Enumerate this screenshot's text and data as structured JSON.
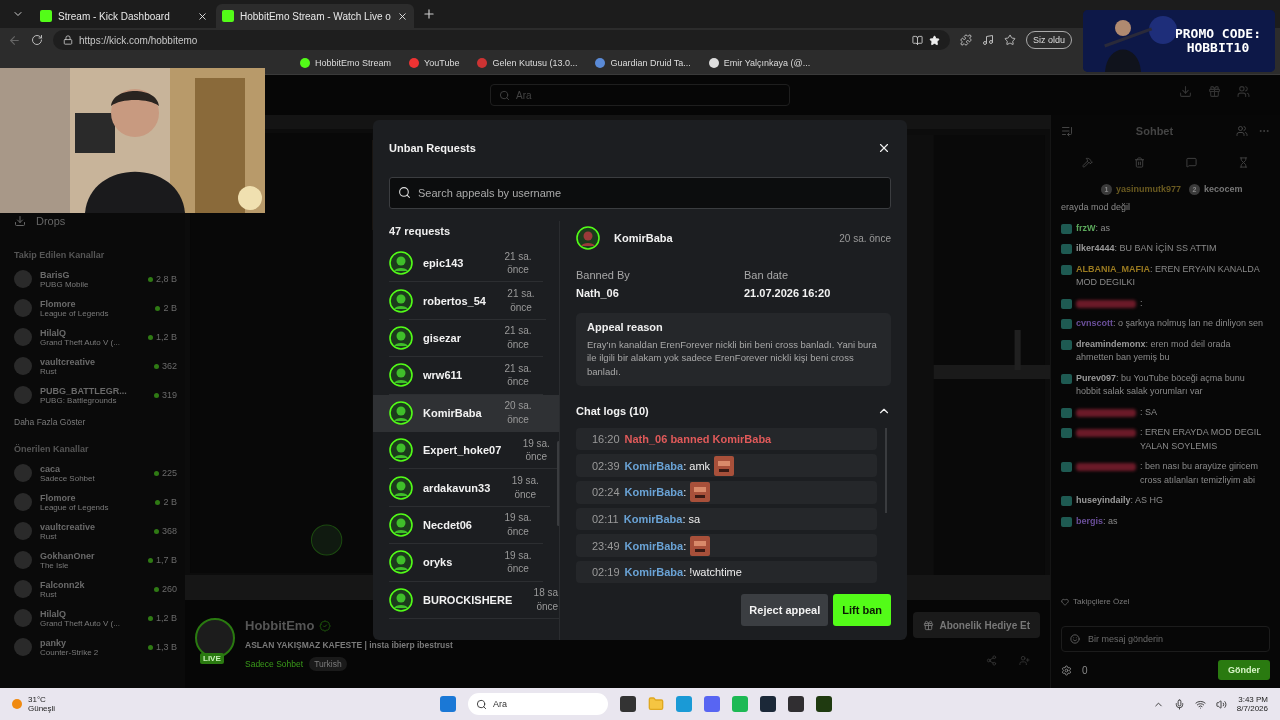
{
  "browser": {
    "tabs": [
      {
        "title": "Stream - Kick Dashboard",
        "selected": false
      },
      {
        "title": "HobbitEmo Stream - Watch Live o",
        "selected": true
      }
    ],
    "url": "https://kick.com/hobbitemo",
    "profile": "Siz oldu",
    "bookmarks": [
      "HobbitEmo Stream",
      "YouTube",
      "Gelen Kutusu (13.0...",
      "Guardian Druid Ta...",
      "Emir Yalçınkaya (@..."
    ]
  },
  "overlay": {
    "promo": [
      "PROMO CODE:",
      "HOBBIT10"
    ]
  },
  "top_nav": {
    "search_placeholder": "Ara"
  },
  "sidebar": {
    "drops": "Drops",
    "followed_title": "Takip Edilen Kanallar",
    "followed": [
      {
        "name": "BarisG",
        "game": "PUBG Mobile",
        "viewers": "2,8 B"
      },
      {
        "name": "Flomore",
        "game": "League of Legends",
        "viewers": "2 B"
      },
      {
        "name": "HilalQ",
        "game": "Grand Theft Auto V (...",
        "viewers": "1,2 B"
      },
      {
        "name": "vaultcreative",
        "game": "Rust",
        "viewers": "362"
      },
      {
        "name": "PUBG_BATTLEGR...",
        "game": "PUBG: Battlegrounds",
        "viewers": "319"
      }
    ],
    "show_more": "Daha Fazla Göster",
    "recommended_title": "Önerilen Kanallar",
    "recommended": [
      {
        "name": "caca",
        "game": "Sadece Sohbet",
        "viewers": "225"
      },
      {
        "name": "Flomore",
        "game": "League of Legends",
        "viewers": "2 B"
      },
      {
        "name": "vaultcreative",
        "game": "Rust",
        "viewers": "368"
      },
      {
        "name": "GokhanOner",
        "game": "The Isle",
        "viewers": "1,7 B"
      },
      {
        "name": "Falconn2k",
        "game": "Rust",
        "viewers": "260"
      },
      {
        "name": "HilalQ",
        "game": "Grand Theft Auto V (...",
        "viewers": "1,2 B"
      },
      {
        "name": "panky",
        "game": "Counter-Strike 2",
        "viewers": "1,3 B"
      }
    ]
  },
  "stream_info": {
    "streamer": "HobbitEmo",
    "live_badge": "LIVE",
    "title": "ASLAN YAKIŞMAZ KAFESTE | insta ibierp ibestrust",
    "category": "Sadece Sohbet",
    "tag": "Turkish",
    "gift_button": "Abonelik Hediye Et"
  },
  "chat": {
    "title": "Sohbet",
    "leaderboard": [
      {
        "rank": "1",
        "name": "yasinumutk977"
      },
      {
        "rank": "2",
        "name": "kecocem"
      }
    ],
    "messages": [
      {
        "kind": "text",
        "text": "erayda mod değil"
      },
      {
        "kind": "user",
        "user": "frzW",
        "color": "#5ba85b",
        "text": ": as"
      },
      {
        "kind": "user",
        "user": "ilker4444",
        "color": "#9a9a9a",
        "text": ": BU BAN İÇİN SS ATTIM"
      },
      {
        "kind": "user",
        "user": "ALBANIA_MAFIA",
        "color": "#9a7a20",
        "text": ": EREN ERYAIN KANALDA MOD DEGILKI"
      },
      {
        "kind": "hidden",
        "color": "#6b1a28",
        "text": ":"
      },
      {
        "kind": "user",
        "user": "cvnscott",
        "color": "#6a4f9a",
        "text": ": o şarkıya nolmuş lan ne dinliyon sen"
      },
      {
        "kind": "user",
        "user": "dreamindemonx",
        "color": "#9a9a9a",
        "text": ": eren mod deil orada ahmetten ban yemiş bu"
      },
      {
        "kind": "user",
        "user": "Purev097",
        "color": "#9a9a9a",
        "text": ": bu YouTube böceği açma bunu hobbit salak salak yorumları var"
      },
      {
        "kind": "hidden",
        "color": "#6b1a28",
        "text": ": SA"
      },
      {
        "kind": "hidden",
        "color": "#6b1a28",
        "text": ": EREN ERAYDA MOD DEGIL YALAN SOYLEMIS"
      },
      {
        "kind": "hidden",
        "color": "#6b1a28",
        "text": ": ben nası bu arayüze giricem cross atılanları temizliyim abi"
      },
      {
        "kind": "user",
        "user": "huseyindaily",
        "color": "#9a9a9a",
        "text": ": AS HG"
      },
      {
        "kind": "user",
        "user": "bergis",
        "color": "#6a4f9a",
        "text": ": as"
      }
    ],
    "followers_only": "Takipçilere Özel",
    "input_placeholder": "Bir mesaj gönderin",
    "points": "0",
    "send": "Gönder"
  },
  "modal": {
    "title": "Unban Requests",
    "search_placeholder": "Search appeals by username",
    "count": "47 requests",
    "requests": [
      {
        "name": "epic143",
        "time": "21 sa. önce",
        "selected": false
      },
      {
        "name": "robertos_54",
        "time": "21 sa. önce",
        "selected": false
      },
      {
        "name": "gisezar",
        "time": "21 sa. önce",
        "selected": false
      },
      {
        "name": "wrw611",
        "time": "21 sa. önce",
        "selected": false
      },
      {
        "name": "KomirBaba",
        "time": "20 sa. önce",
        "selected": true
      },
      {
        "name": "Expert_hoke07",
        "time": "19 sa. önce",
        "selected": false
      },
      {
        "name": "ardakavun33",
        "time": "19 sa. önce",
        "selected": false
      },
      {
        "name": "Necdet06",
        "time": "19 sa. önce",
        "selected": false
      },
      {
        "name": "oryks",
        "time": "19 sa. önce",
        "selected": false
      },
      {
        "name": "BUROCKISHERE",
        "time": "18 sa. önce",
        "selected": false
      }
    ],
    "detail": {
      "name": "KomirBaba",
      "time": "20 sa. önce",
      "banned_by_label": "Banned By",
      "banned_by": "Nath_06",
      "ban_date_label": "Ban date",
      "ban_date": "21.07.2026 16:20",
      "appeal_title": "Appeal reason",
      "appeal_text": "Eray'ın kanaldan ErenForever nickli biri beni cross banladı. Yani bura ile ilgili bir alakam yok sadece ErenForever nickli kişi beni cross banladı.",
      "logs_title": "Chat logs (10)",
      "logs_expanded": true,
      "logs": [
        {
          "kind": "ban",
          "time": "16:20",
          "text": "Nath_06 banned KomirBaba"
        },
        {
          "kind": "message",
          "time": "02:39",
          "user": "KomirBaba",
          "text": ": amk",
          "emote": true
        },
        {
          "kind": "message",
          "time": "02:24",
          "user": "KomirBaba",
          "text": ":",
          "emote": true
        },
        {
          "kind": "message",
          "time": "02:11",
          "user": "KomirBaba",
          "text": ": sa",
          "emote": false
        },
        {
          "kind": "message",
          "time": "23:49",
          "user": "KomirBaba",
          "text": ":",
          "emote": true
        },
        {
          "kind": "message",
          "time": "02:19",
          "user": "KomirBaba",
          "text": ": !watchtime",
          "emote": false
        }
      ]
    },
    "reject": "Reject appeal",
    "lift": "Lift ban"
  },
  "taskbar": {
    "temperature": "31°C",
    "weather": "Güneşli",
    "search": "Ara",
    "time": "3:43 PM",
    "date": "8/7/2026"
  }
}
